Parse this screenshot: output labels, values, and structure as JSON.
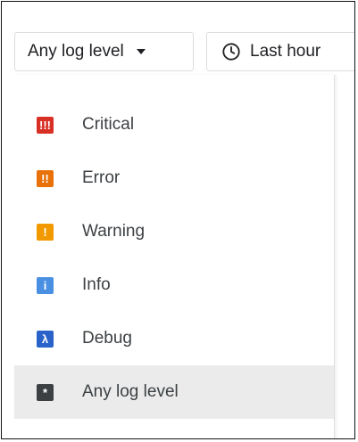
{
  "toolbar": {
    "level_button_label": "Any log level",
    "time_button_label": "Last hour"
  },
  "menu": {
    "items": [
      {
        "label": "Critical",
        "glyph": "!!!",
        "color": "#d93025",
        "icon": "critical-icon"
      },
      {
        "label": "Error",
        "glyph": "!!",
        "color": "#e8710a",
        "icon": "error-icon"
      },
      {
        "label": "Warning",
        "glyph": "!",
        "color": "#f29900",
        "icon": "warning-icon"
      },
      {
        "label": "Info",
        "glyph": "i",
        "color": "#4a90e2",
        "icon": "info-icon"
      },
      {
        "label": "Debug",
        "glyph": "λ",
        "color": "#2962c9",
        "icon": "debug-icon"
      },
      {
        "label": "Any log level",
        "glyph": "*",
        "color": "#3c4043",
        "icon": "any-level-icon"
      }
    ],
    "selected_index": 5
  }
}
